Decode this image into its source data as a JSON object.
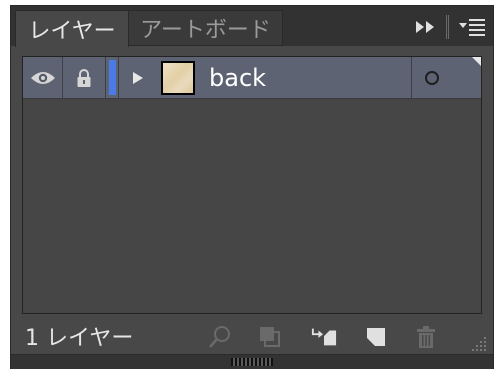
{
  "tabs": [
    {
      "label": "レイヤー",
      "active": true
    },
    {
      "label": "アートボード",
      "active": false
    }
  ],
  "tab_tools": {
    "collapse_icon": "double-chevron-right-icon",
    "menu_icon": "panel-menu-icon"
  },
  "layers": [
    {
      "name": "back",
      "visible": true,
      "locked": true,
      "color": "#4a7be6",
      "expanded": false,
      "selected": true
    }
  ],
  "footer": {
    "count_label": "1 レイヤー",
    "buttons": [
      {
        "icon": "search-icon",
        "enabled": false
      },
      {
        "icon": "clipping-mask-icon",
        "enabled": false
      },
      {
        "icon": "new-sublayer-icon",
        "enabled": true
      },
      {
        "icon": "new-layer-icon",
        "enabled": true
      },
      {
        "icon": "trash-icon",
        "enabled": false
      }
    ]
  },
  "colors": {
    "panel_bg": "#484848",
    "selected_row": "#5d6372",
    "layer_color_bar": "#4a7be6"
  }
}
